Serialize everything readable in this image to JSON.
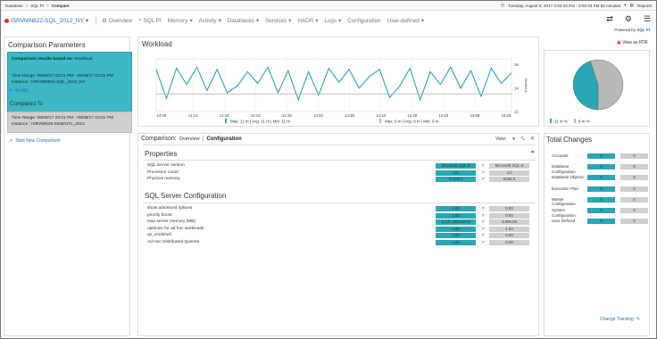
{
  "breadcrumb": [
    "Database",
    "SQL PI",
    "Compare"
  ],
  "topright": {
    "datetime": "Tuesday, August 8, 2017 2:02:43 PM - 3:02:43 PM 60 minutes",
    "reports": "Reports"
  },
  "nav": {
    "instance": "ISRVMN822-SQL_2012_NY",
    "items": [
      "Overview",
      "SQL PI",
      "Memory",
      "Activity",
      "Databases",
      "Services",
      "HADR",
      "Logs",
      "Configuration",
      "User-defined"
    ],
    "powered_by": "Powered by",
    "powered_brand": "SQL PI"
  },
  "left": {
    "title": "Comparison Parameters",
    "based_on": "Comparison results based on:",
    "based_val": "Workload",
    "time1": "Time Range: 08/08/17 03:01 PM - 08/08/17 04:01 PM",
    "inst1": "Instance : ISRVMN822-SQL_2012_NY",
    "modify": "Modify",
    "compared_to": "Compared To",
    "time2": "Time Range: 08/08/17 03:01 PM - 08/08/17 04:01 PM",
    "inst2": "Instance : ISRVMN16-X64ENT1_2012",
    "start_new": "Start New Comparison"
  },
  "workload": {
    "title": "Workload",
    "view_pdf": "View as PDF",
    "ylabel": "Sessions",
    "ticks_x": [
      "14:08",
      "14:13",
      "14:18",
      "14:23",
      "14:28",
      "14:33",
      "14:38",
      "14:43",
      "14:48",
      "14:53",
      "14:58",
      "15:03"
    ],
    "ticks_y": [
      "16",
      "14",
      "12"
    ],
    "legend1": "Max: 11 m | Avg: 11 m | Min: 11 m",
    "legend2": "Max: 9 m | Avg: 9 m | Min: 9 m",
    "pie_legend1": "11 m %",
    "pie_legend2": "9 m %",
    "colors": {
      "teal": "#2aa6b4",
      "gray": "#b8b8b8"
    }
  },
  "chart_data": {
    "type": "line",
    "x": [
      "14:08",
      "14:13",
      "14:18",
      "14:23",
      "14:28",
      "14:33",
      "14:38",
      "14:43",
      "14:48",
      "14:53",
      "14:58",
      "15:03"
    ],
    "series": [
      {
        "values": [
          15.6,
          13.1,
          15.7,
          14.3,
          15.8,
          13.8,
          15.6,
          13.6,
          14.2,
          15.4,
          14.4,
          15.8,
          13.6,
          15.5,
          13.0,
          15.4,
          13.4,
          15.7,
          14.5,
          15.6,
          14.0,
          15.0,
          15.6,
          13.2,
          14.2,
          15.7,
          13.0,
          15.4,
          14.3,
          15.8,
          14.0,
          15.5,
          13.3,
          15.7,
          14.4,
          15.3
        ]
      },
      {
        "values": [
          13.5,
          13.5,
          13.5,
          13.5,
          13.5,
          13.5,
          13.5,
          13.5,
          13.5,
          13.5,
          13.5,
          13.5,
          13.5,
          13.5,
          13.5,
          13.5,
          13.5,
          13.5,
          13.5,
          13.5,
          13.5,
          13.5,
          13.5,
          13.5,
          13.5,
          13.5,
          13.5,
          13.5,
          13.5,
          13.5,
          13.5,
          13.5,
          13.5,
          13.5,
          13.5,
          13.5
        ]
      }
    ],
    "ylim": [
      12,
      16.5
    ]
  },
  "pie_data": {
    "type": "pie",
    "slices": [
      {
        "label": "11 m %",
        "value": 45
      },
      {
        "label": "9 m %",
        "value": 55
      }
    ]
  },
  "compare": {
    "tab_label": "Comparison:",
    "tab_overview": "Overview",
    "tab_config": "Configuration",
    "view_label": "View:",
    "properties_title": "Properties",
    "properties": [
      {
        "label": "SQL Server version",
        "a": "Microsoft SQL S",
        "b": "Microsoft SQL S"
      },
      {
        "label": "Processor count",
        "a": "4.0",
        "b": "4.0"
      },
      {
        "label": "Physical memory",
        "a": "6,124.0",
        "b": "8182.0"
      }
    ],
    "config_title": "SQL Server Configuration",
    "config": [
      {
        "label": "show advanced options",
        "a": "1.00",
        "b": "0.00"
      },
      {
        "label": "priority boost",
        "a": "1.00",
        "b": "0.00"
      },
      {
        "label": "max server memory (MB)",
        "a": "2,147,483,647.0",
        "b": "4,096.00"
      },
      {
        "label": "optimize for ad hoc workloads",
        "a": "1.00",
        "b": "1.00"
      },
      {
        "label": "xp_cmdshell",
        "a": "1.00",
        "b": "0.00"
      },
      {
        "label": "Ad Hoc Distributed Queries",
        "a": "1.00",
        "b": "0.00"
      }
    ]
  },
  "total": {
    "title": "Total Changes",
    "rows": [
      {
        "label": "Accounts",
        "a": "0",
        "b": "0"
      },
      {
        "label": "Database Configuration",
        "a": "0",
        "b": "0"
      },
      {
        "label": "Database Objects",
        "a": "0",
        "b": "0"
      },
      {
        "label": "Execution Plan",
        "a": "0",
        "b": "0"
      },
      {
        "label": "Master Configuration",
        "a": "0",
        "b": "0"
      },
      {
        "label": "System Configuration",
        "a": "0",
        "b": "0"
      },
      {
        "label": "User Defined",
        "a": "0",
        "b": "0"
      }
    ],
    "change_tracking": "Change Tracking"
  }
}
